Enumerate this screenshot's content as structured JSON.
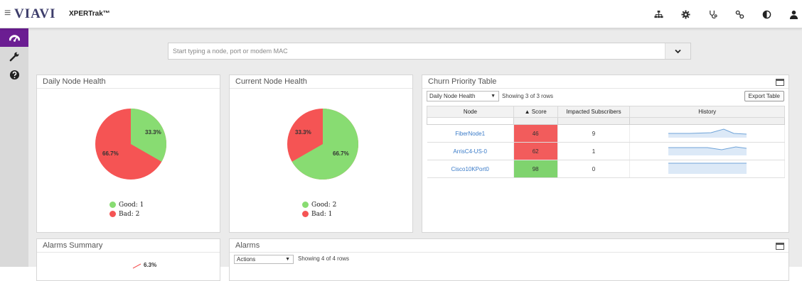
{
  "header": {
    "menu_glyph": "≡",
    "logo": "VIAVI",
    "product": "XPERTrak™",
    "icons": [
      "topology-icon",
      "settings-gear-icon",
      "stethoscope-icon",
      "link-icon",
      "contrast-icon",
      "user-icon"
    ]
  },
  "sidebar": {
    "items": [
      {
        "name": "dashboard-icon",
        "active": true
      },
      {
        "name": "wrench-icon",
        "active": false
      },
      {
        "name": "help-icon",
        "active": false
      }
    ],
    "accent": "#6b1d92"
  },
  "search": {
    "placeholder": "Start typing a node, port or modem MAC",
    "value": ""
  },
  "daily_node_health": {
    "title": "Daily Node Health",
    "good_pct_label": "33.3%",
    "bad_pct_label": "66.7%",
    "legend_good": "Good: 1",
    "legend_bad": "Bad: 2",
    "good_fraction": 0.333,
    "colors": {
      "good": "#88dc72",
      "bad": "#f55454"
    }
  },
  "current_node_health": {
    "title": "Current Node Health",
    "good_pct_label": "66.7%",
    "bad_pct_label": "33.3%",
    "legend_good": "Good: 2",
    "legend_bad": "Bad: 1",
    "good_fraction": 0.667,
    "colors": {
      "good": "#88dc72",
      "bad": "#f55454"
    }
  },
  "churn": {
    "title": "Churn Priority Table",
    "select_value": "Daily Node Health",
    "showing": "Showing 3 of 3 rows",
    "export_label": "Export Table",
    "columns": [
      "Node",
      "▲ Score",
      "Impacted Subscribers",
      "History"
    ],
    "rows": [
      {
        "node": "FiberNode1",
        "score": "46",
        "impacted": "9",
        "status": "bad"
      },
      {
        "node": "ArrisC4-US-0",
        "score": "62",
        "impacted": "1",
        "status": "bad"
      },
      {
        "node": "Cisco10KPort0",
        "score": "98",
        "impacted": "0",
        "status": "good"
      }
    ]
  },
  "alarms_summary": {
    "title": "Alarms Summary",
    "partial_label": "6.3%"
  },
  "alarms": {
    "title": "Alarms",
    "select_value": "Actions",
    "showing": "Showing 4 of 4 rows"
  }
}
